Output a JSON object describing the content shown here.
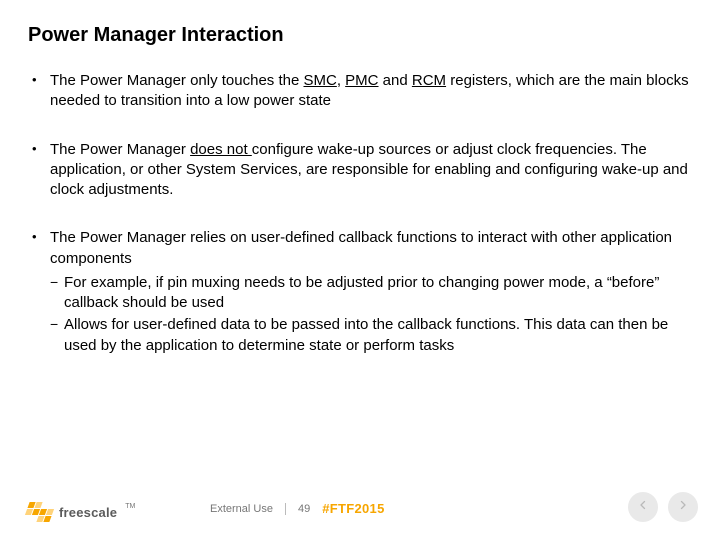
{
  "title": "Power Manager Interaction",
  "bullets": {
    "b1": {
      "pre": "The Power Manager only touches the ",
      "u1": "SMC",
      "mid1": ", ",
      "u2": "PMC",
      "mid2": " and ",
      "u3": "RCM",
      "post": " registers, which are the main blocks needed to transition into a low power state"
    },
    "b2": {
      "pre": "The Power Manager ",
      "u1": "does not ",
      "post": "configure wake-up sources or adjust clock frequencies. The application, or other System Services, are responsible for enabling and configuring wake-up and clock adjustments."
    },
    "b3": {
      "text": "The Power Manager relies on user-defined callback functions to interact with other application components",
      "sub1": "For example, if pin muxing needs to be adjusted prior to changing power mode, a “before” callback should be used",
      "sub2": "Allows for user-defined data to be passed into the callback functions. This data can then be used by the application to determine state or perform tasks"
    }
  },
  "footer": {
    "brand": "freescale",
    "tm": "TM",
    "external": "External Use",
    "page": "49",
    "hashtag": "#FTF2015"
  }
}
